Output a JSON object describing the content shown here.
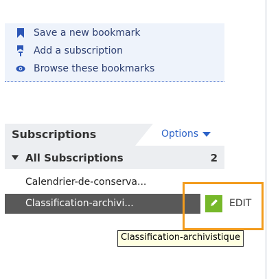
{
  "bookmark_actions": {
    "save_label": "Save a new bookmark",
    "subscribe_label": "Add a subscription",
    "browse_label": "Browse these bookmarks"
  },
  "subscriptions": {
    "title": "Subscriptions",
    "options_label": "Options",
    "all_label": "All Subscriptions",
    "all_count": "2",
    "items": [
      {
        "label": "Calendrier-de-conserva..."
      },
      {
        "label": "Classification-archivi..."
      }
    ],
    "edit_label": "EDIT",
    "tooltip": "Classification-archivistique"
  },
  "colors": {
    "link": "#2d63c8",
    "edit_green": "#76b82a",
    "highlight_orange": "#f29b1c",
    "selected_row": "#595959"
  },
  "icons": [
    "bookmark-icon",
    "subscription-icon",
    "eye-icon",
    "pencil-icon",
    "chevron-down-icon",
    "caret-down-icon"
  ]
}
